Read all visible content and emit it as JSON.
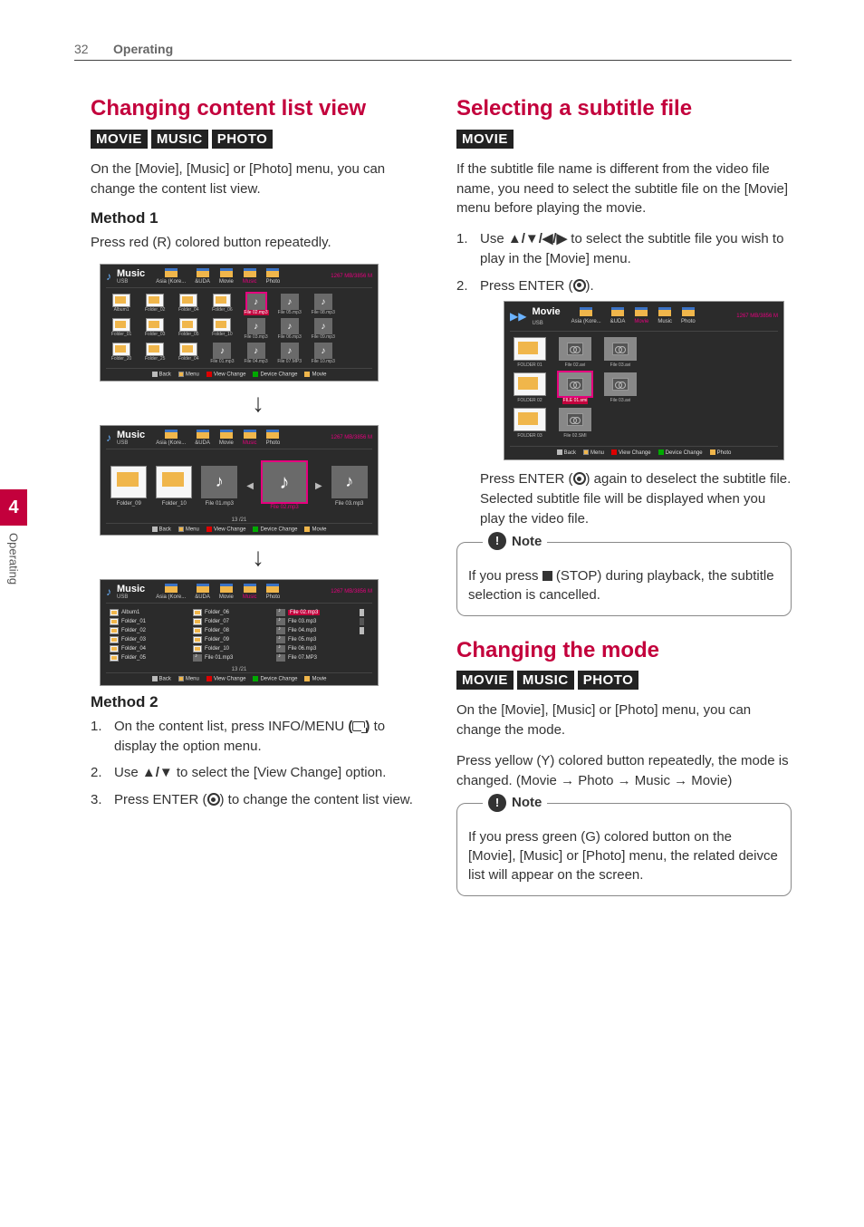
{
  "page": {
    "number": "32",
    "section": "Operating",
    "side_number": "4",
    "side_text": "Operating"
  },
  "left": {
    "title": "Changing content list view",
    "badges": [
      "MOVIE",
      "MUSIC",
      "PHOTO"
    ],
    "intro": "On the [Movie], [Music] or [Photo] menu, you can change the content list view.",
    "method1": {
      "title": "Method 1",
      "text": "Press red (R) colored button repeatedly."
    },
    "ss_common": {
      "title": "Music",
      "sub": "USB",
      "tabs": [
        "Asia (Kore...",
        "&UDA",
        "Movie",
        "Music",
        "Photo"
      ],
      "storage": "1267 MB/3856 M",
      "footer": {
        "back": "Back",
        "menu": "Menu",
        "view": "View Change",
        "device": "Device Change",
        "movie": "Movie"
      }
    },
    "ss1": {
      "row1": [
        "Album1",
        "Folder_02",
        "Folder_04",
        "Folder_06",
        "File 02.mp3",
        "File 05.mp3",
        "File 08.mp3"
      ],
      "row2": [
        "Folder_01",
        "Folder_03",
        "Folder_05",
        "Folder_10",
        "File 03.mp3",
        "File 06.mp3",
        "File 09.mp3"
      ],
      "row3": [
        "Folder_20",
        "Folder_25",
        "Folder_04",
        "File 01.mp3",
        "File 04.mp3",
        "File 07.MP3",
        "File 10.mp3"
      ],
      "selected": "File 02.mp3"
    },
    "ss2": {
      "items": [
        "Folder_09",
        "Folder_10",
        "File 01.mp3",
        "File 02.mp3",
        "File 03.mp3"
      ],
      "selected": "File 02.mp3",
      "count": "13 /21"
    },
    "ss3": {
      "col1": [
        "Album1",
        "Folder_01",
        "Folder_02",
        "Folder_03",
        "Folder_04",
        "Folder_05"
      ],
      "col2": [
        "Folder_06",
        "Folder_07",
        "Folder_08",
        "Folder_09",
        "Folder_10",
        "File 01.mp3"
      ],
      "col3": [
        "File 02.mp3",
        "File 03.mp3",
        "File 04.mp3",
        "File 05.mp3",
        "File 06.mp3",
        "File 07.MP3"
      ],
      "selected": "File 02.mp3",
      "count": "13 /21"
    },
    "method2": {
      "title": "Method 2",
      "steps": [
        {
          "pre": "On the content list, press INFO/MENU ",
          "post": " to display the option menu."
        },
        {
          "pre": "Use ",
          "mid": " to select the [View Change] option."
        },
        {
          "pre": "Press ENTER (",
          "post": ") to change the content list view."
        }
      ],
      "bold": {
        "infomenu": "(",
        "infomenu2": ")",
        "udarrows": "▲/▼"
      }
    }
  },
  "right": {
    "subtitle": {
      "title": "Selecting a subtitle file",
      "badges": [
        "MOVIE"
      ],
      "intro": "If the subtitle file name is different from the video file name, you need to select the subtitle file on the [Movie] menu before playing the movie.",
      "steps": [
        {
          "pre": "Use ",
          "arrows": "▲/▼/◀/▶",
          "post": " to select the subtitle file you wish to play in the [Movie] menu."
        },
        {
          "pre": "Press ENTER (",
          "post": ")."
        }
      ],
      "ss": {
        "title": "Movie",
        "sub": "USB",
        "tabs": [
          "Asia (Kore...",
          "&UDA",
          "Movie",
          "Music",
          "Photo"
        ],
        "storage": "1267 MB/3856 M",
        "cells": [
          {
            "label": "FOLDER 01",
            "type": "folder"
          },
          {
            "label": "File 02.avi",
            "type": "file"
          },
          {
            "label": "File 03.avi",
            "type": "file"
          },
          {
            "label": "FOLDER 02",
            "type": "folder"
          },
          {
            "label": "FILE 01.smi",
            "type": "smi",
            "selected": true
          },
          {
            "label": "File 03.avi",
            "type": "file"
          },
          {
            "label": "FOLDER 03",
            "type": "folder"
          },
          {
            "label": "File 02.SMI",
            "type": "smi"
          }
        ],
        "footer": {
          "back": "Back",
          "menu": "Menu",
          "view": "View Change",
          "device": "Device Change",
          "photo": "Photo"
        }
      },
      "after": "Press ENTER (⊙) again to deselect the subtitle file. Selected subtitle file will be displayed when you play the video file.",
      "note_label": "Note",
      "note": "If you press ■ (STOP) during playback, the subtitle selection is cancelled."
    },
    "mode": {
      "title": "Changing the mode",
      "badges": [
        "MOVIE",
        "MUSIC",
        "PHOTO"
      ],
      "intro": "On the [Movie], [Music] or [Photo] menu, you can change the mode.",
      "body_pre": "Press yellow (Y) colored button repeatedly, the mode is changed. (Movie ",
      "body_mid1": " Photo ",
      "body_mid2": " Music ",
      "body_post": " Movie)",
      "note_label": "Note",
      "note": "If you press green (G) colored button on the [Movie], [Music] or [Photo] menu, the related deivce list will appear on the screen."
    }
  }
}
